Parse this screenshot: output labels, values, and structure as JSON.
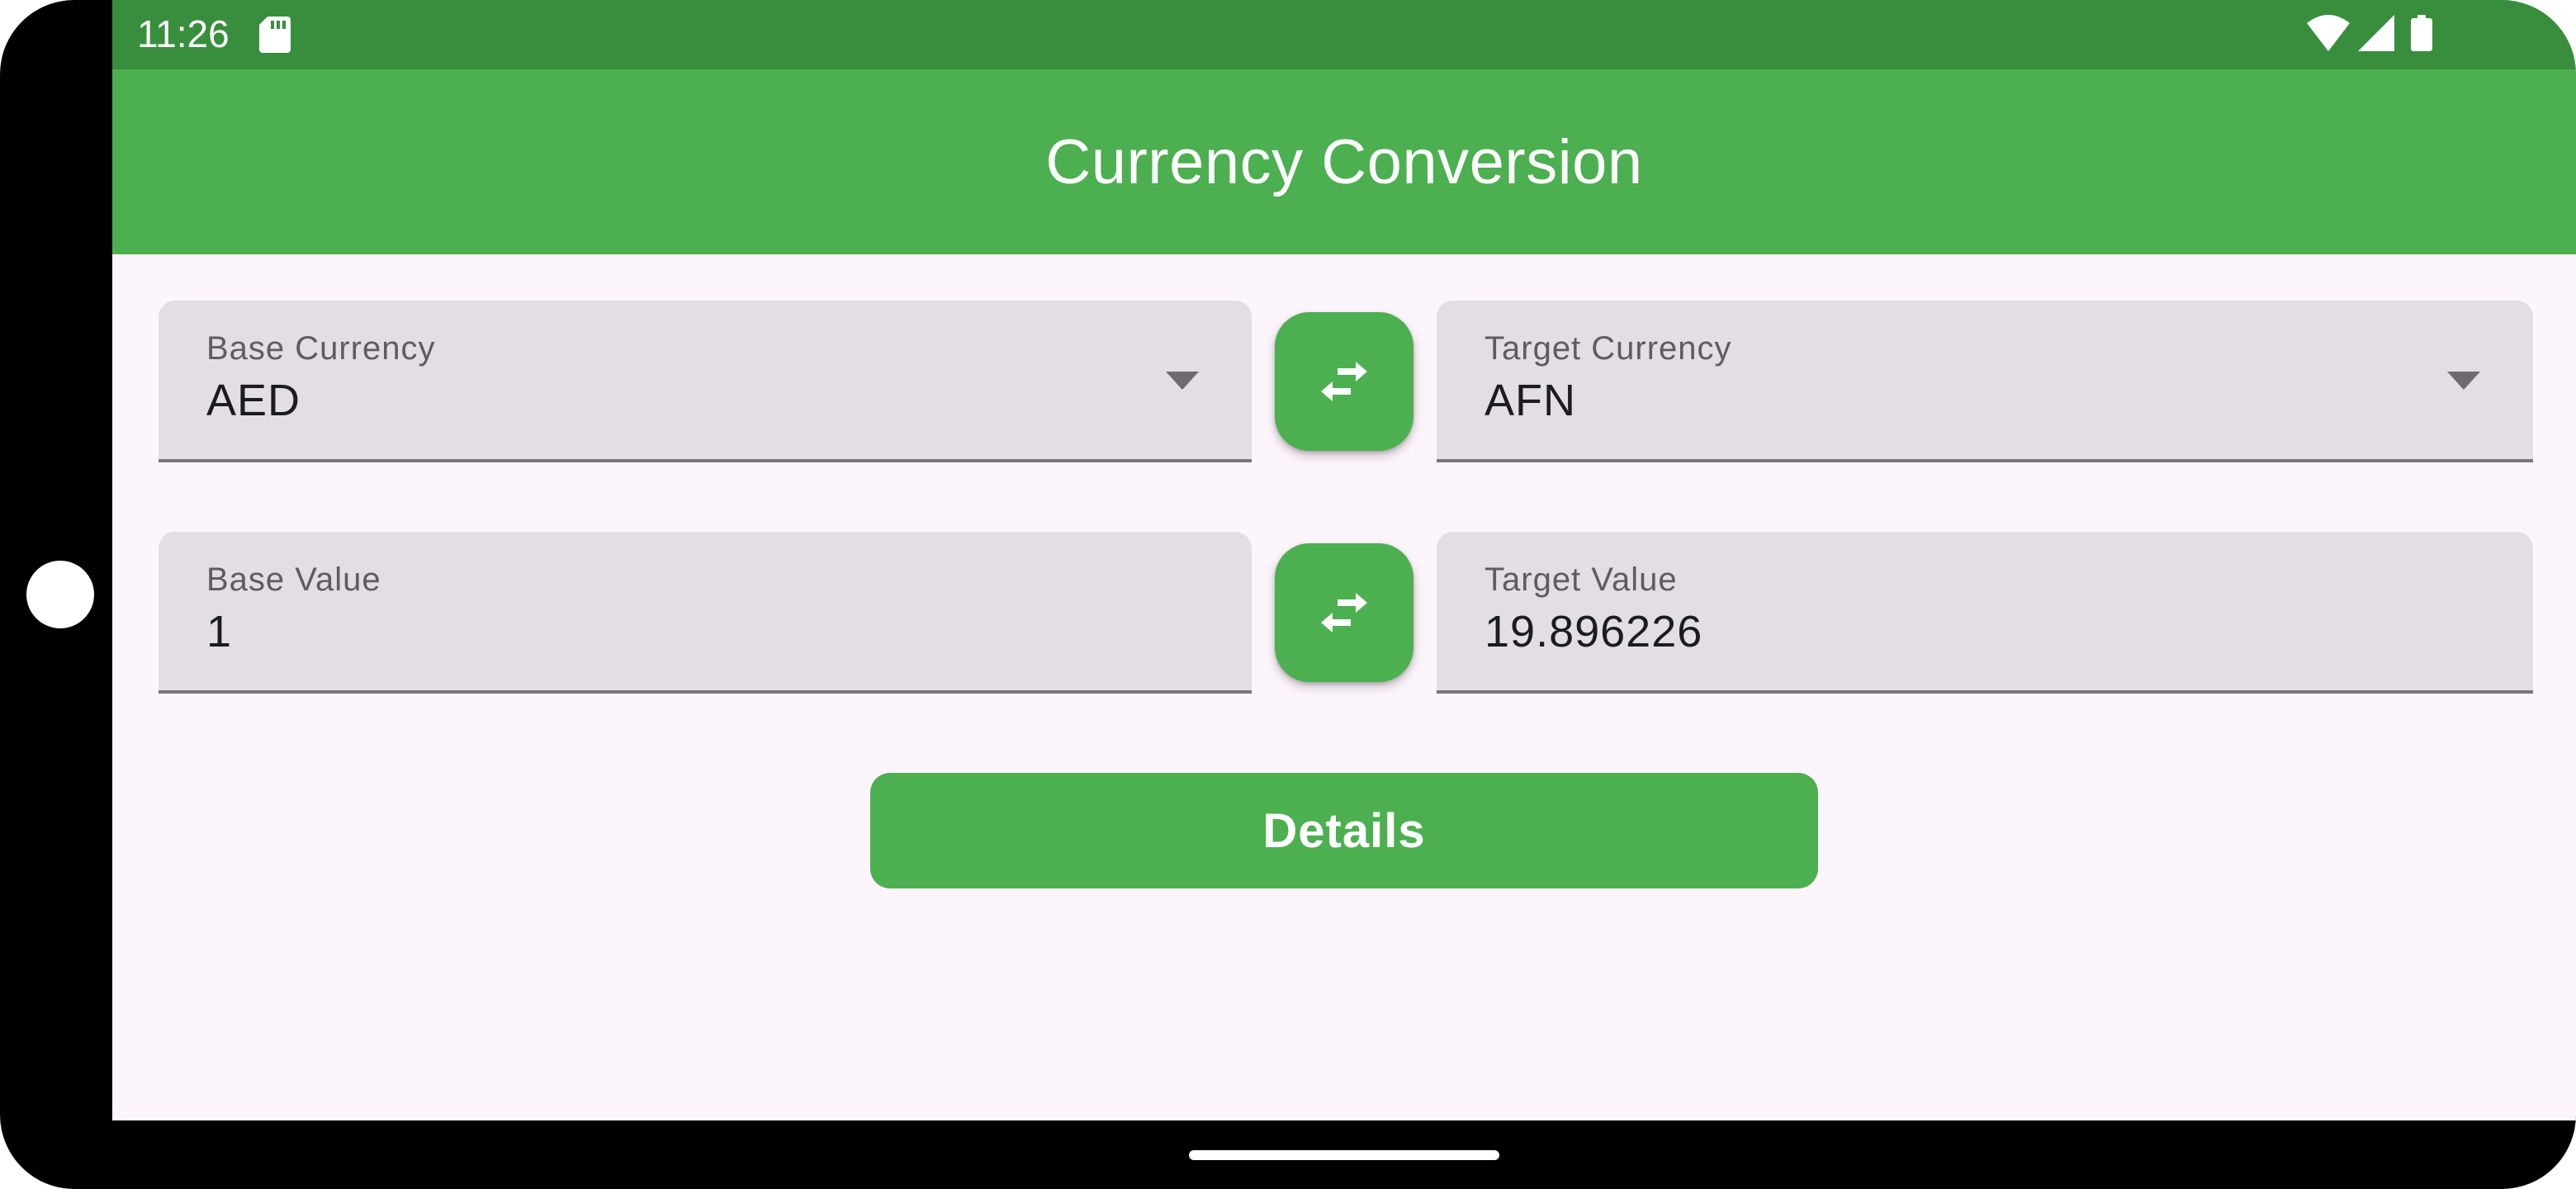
{
  "status_bar": {
    "time": "11:26",
    "icons": [
      "sd-card-icon",
      "wifi-icon",
      "cellular-signal-icon",
      "battery-icon"
    ]
  },
  "app_bar": {
    "title": "Currency Conversion"
  },
  "base_currency": {
    "label": "Base Currency",
    "value": "AED"
  },
  "target_currency": {
    "label": "Target Currency",
    "value": "AFN"
  },
  "base_value": {
    "label": "Base Value",
    "value": "1"
  },
  "target_value": {
    "label": "Target Value",
    "value": "19.896226"
  },
  "details_button": {
    "label": "Details"
  },
  "colors": {
    "primary": "#4caf50",
    "status_bar": "#388e3c",
    "background": "#fcf5fb",
    "field_fill": "#e2dee3"
  }
}
